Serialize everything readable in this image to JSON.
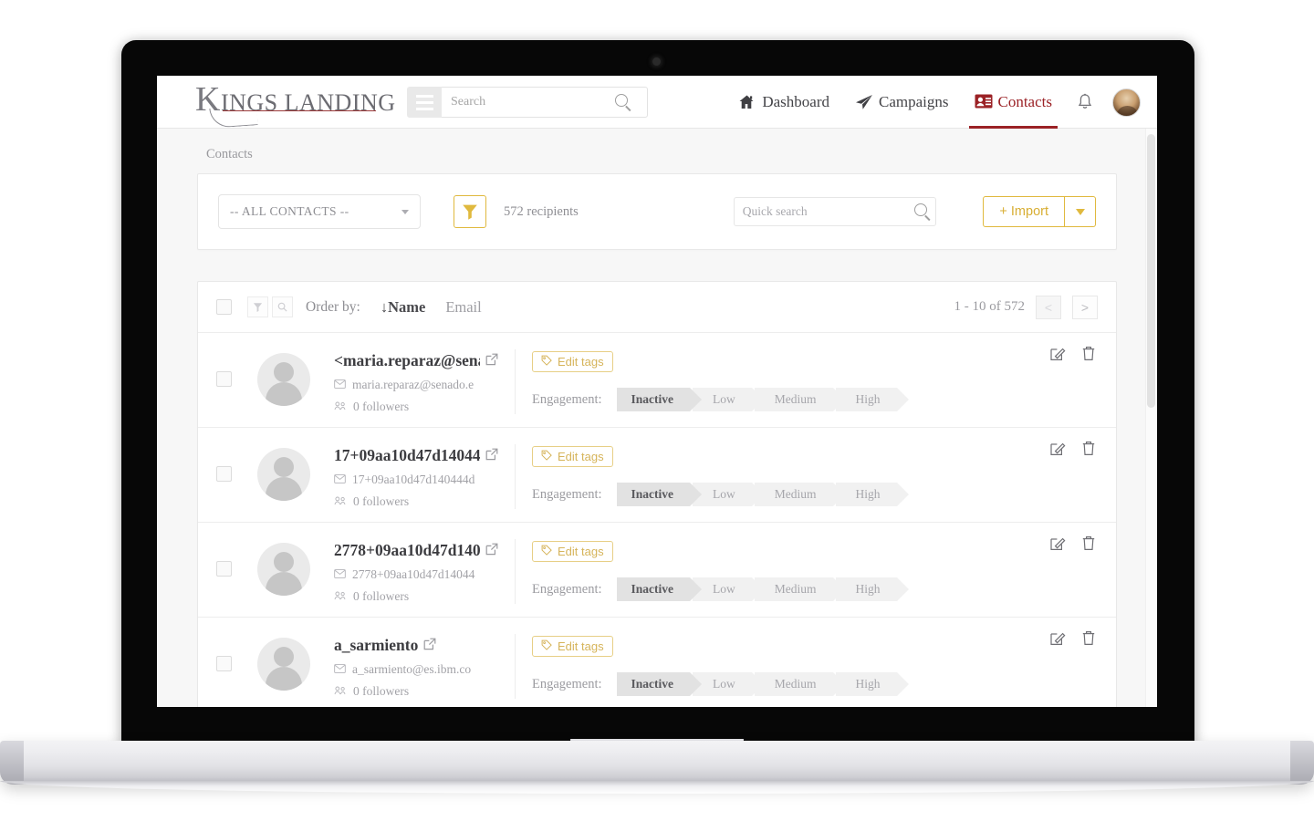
{
  "brand": {
    "cap": "K",
    "name": "INGS LANDING"
  },
  "topbar": {
    "search_placeholder": "Search",
    "search_value": "",
    "menu_icon": "hamburger-icon",
    "search_icon": "search-icon",
    "bell_icon": "bell-icon",
    "avatar_alt": "user-avatar"
  },
  "nav": [
    {
      "label": "Dashboard",
      "icon": "home-icon",
      "active": false
    },
    {
      "label": "Campaigns",
      "icon": "paper-plane-icon",
      "active": false
    },
    {
      "label": "Contacts",
      "icon": "contact-card-icon",
      "active": true
    }
  ],
  "breadcrumb": "Contacts",
  "filter_bar": {
    "select_value": "-- ALL CONTACTS --",
    "filter_icon": "funnel-icon",
    "recipients": "572 recipients",
    "quick_search_placeholder": "Quick search",
    "quick_search_value": "",
    "import_label": "+ Import",
    "import_caret_icon": "caret-down-icon"
  },
  "list_header": {
    "select_all_icon": "checkbox-icon",
    "filter_icon": "funnel-icon",
    "search_icon": "search-icon",
    "order_by_label": "Order by:",
    "order_options": [
      {
        "label": "↓Name",
        "active": true
      },
      {
        "label": "Email",
        "active": false
      }
    ],
    "pager_text": "1 - 10 of 572",
    "prev_label": "<",
    "next_label": ">"
  },
  "engagement": {
    "label": "Engagement:",
    "levels": [
      "Inactive",
      "Low",
      "Medium",
      "High"
    ],
    "selected": "Inactive"
  },
  "row_common": {
    "tag_label": "Edit tags",
    "tag_icon": "tag-icon",
    "external_link_icon": "external-link-icon",
    "email_icon": "envelope-icon",
    "followers_icon": "people-icon",
    "edit_icon": "edit-pencil-icon",
    "delete_icon": "trash-icon"
  },
  "contacts": [
    {
      "name": "<maria.reparaz@senad",
      "email": "maria.reparaz@senado.e",
      "followers": "0 followers"
    },
    {
      "name": "17+09aa10d47d14044",
      "email": "17+09aa10d47d140444d",
      "followers": "0 followers"
    },
    {
      "name": "2778+09aa10d47d140.",
      "email": "2778+09aa10d47d14044",
      "followers": "0 followers"
    },
    {
      "name": "a_sarmiento",
      "email": "a_sarmiento@es.ibm.co",
      "followers": "0 followers"
    }
  ],
  "colors": {
    "brand_red": "#9b2226",
    "gold": "#e0b93e",
    "text_dark": "#3c3c40",
    "text_muted": "#9a9a9f"
  }
}
